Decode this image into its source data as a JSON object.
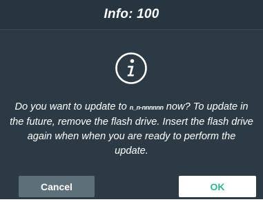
{
  "dialog": {
    "title": "Info: 100",
    "icon": "info-icon",
    "message": {
      "before_version": "Do you want to update to ",
      "version": "n_n-nnnnnn",
      "after_version": " now? To update in the future, remove the flash drive. Insert the flash drive again when when you are ready to perform the update."
    },
    "buttons": {
      "cancel_label": "Cancel",
      "ok_label": "OK"
    }
  },
  "colors": {
    "background": "#2b3a44",
    "title_bar": "#263540",
    "cancel_button": "#5d7079",
    "ok_button": "#ffffff",
    "ok_text": "#2eb48a"
  }
}
